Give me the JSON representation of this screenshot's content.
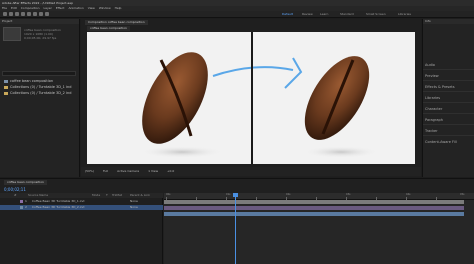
{
  "window": {
    "title": "Adobe After Effects 2022 - /Untitled Project.aep"
  },
  "menu": {
    "items": [
      "File",
      "Edit",
      "Composition",
      "Layer",
      "Effect",
      "Animation",
      "View",
      "Window",
      "Help"
    ]
  },
  "toolbar": {
    "workspaces": [
      "Default",
      "Review",
      "Learn",
      "Standard",
      "Small Screen",
      "Libraries"
    ]
  },
  "project": {
    "panel_title": "Project",
    "comp_name": "coffee bean composition",
    "info": [
      "1920 x 1080 (1.00)",
      "0;00;05;00, 29.97 fps"
    ],
    "items": [
      {
        "name": "coffee bean composition"
      },
      {
        "name": "Collections (0) / Turntable 3D_1 ind"
      },
      {
        "name": "Collections (0) / Turntable 3D_2 ind"
      }
    ]
  },
  "viewer": {
    "tab": "Composition coffee bean composition",
    "sub_tab": "coffee bean composition",
    "footer": [
      "(50%)",
      "Full",
      "Active Camera",
      "1 View",
      "+0.0"
    ]
  },
  "right_panel": {
    "header": "Info",
    "items": [
      "Audio",
      "Preview",
      "Effects & Presets",
      "Libraries",
      "Character",
      "Paragraph",
      "Tracker",
      "Content-Aware Fill"
    ]
  },
  "timeline": {
    "tab": "coffee bean composition",
    "timecode": "0;00;02;11",
    "columns": [
      "#",
      "Source Name",
      "Mode",
      "T",
      "TrkMat",
      "Parent & Link"
    ],
    "layers": [
      {
        "index": "1",
        "name": "Coffee Bean 3D Turntable 3D_1.ind",
        "mode": "None",
        "color": "#8b6fa8"
      },
      {
        "index": "2",
        "name": "Coffee Bean 3D Turntable 3D_2.ind",
        "mode": "None",
        "color": "#6f8ba8"
      }
    ],
    "ruler_labels": [
      "00s",
      "01s",
      "02s",
      "03s",
      "04s",
      "05s"
    ],
    "accent": "#4a90e2"
  }
}
